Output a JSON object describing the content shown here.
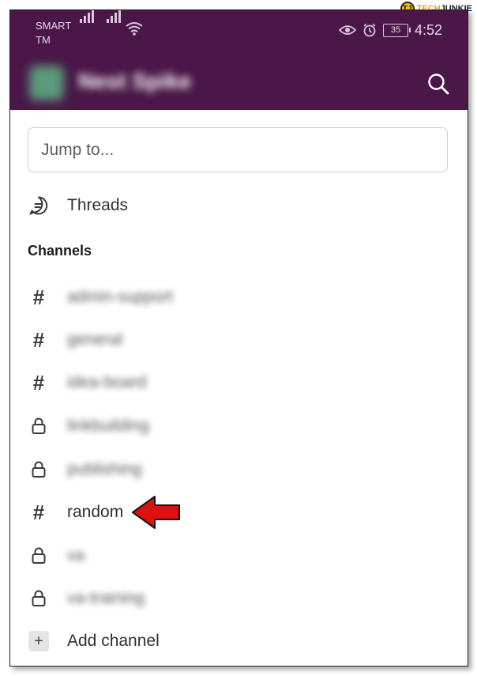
{
  "status_bar": {
    "carrier": "SMART TM",
    "battery": "35",
    "time": "4:52"
  },
  "header": {
    "workspace_name": "Nest Spike"
  },
  "search": {
    "placeholder": "Jump to..."
  },
  "threads": {
    "label": "Threads"
  },
  "channels": {
    "title": "Channels",
    "items": [
      {
        "label": "admin-support",
        "private": false
      },
      {
        "label": "general",
        "private": false
      },
      {
        "label": "idea-board",
        "private": false
      },
      {
        "label": "linkbuilding",
        "private": true
      },
      {
        "label": "publishing",
        "private": true
      },
      {
        "label": "random",
        "private": false
      },
      {
        "label": "va",
        "private": true
      },
      {
        "label": "va-training",
        "private": true
      }
    ],
    "add_label": "Add channel"
  },
  "watermark": {
    "part1": "TECH",
    "part2": "JUNKIE"
  },
  "colors": {
    "header_bg": "#4a1748",
    "annotation_arrow": "#e01010"
  }
}
